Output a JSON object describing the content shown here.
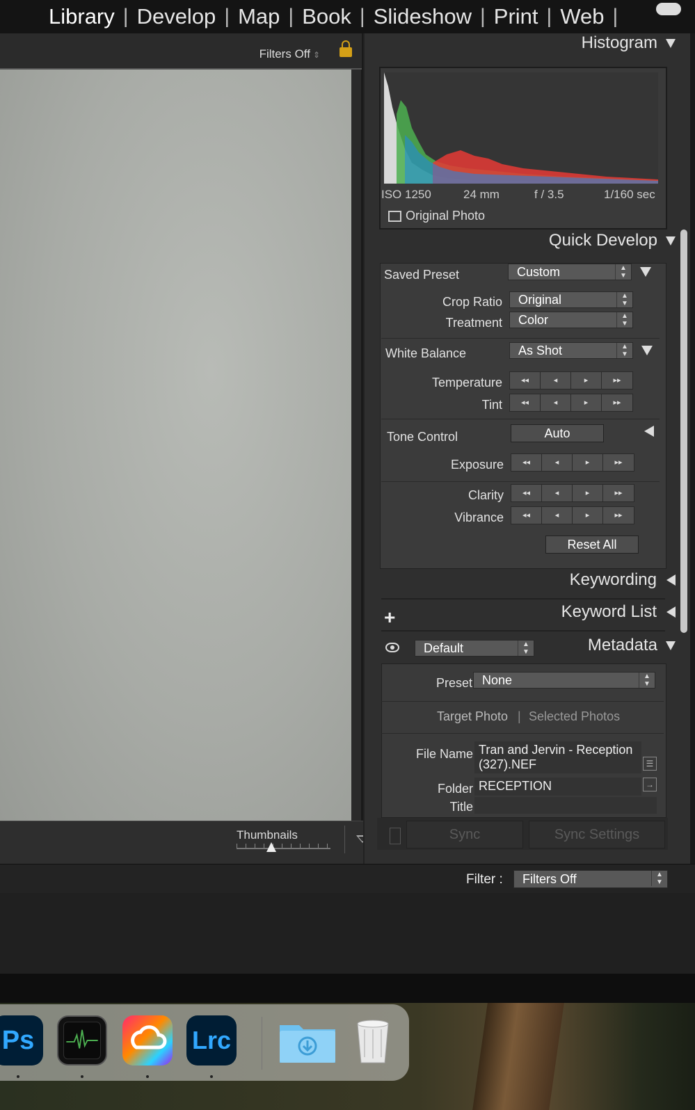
{
  "modules": [
    "Library",
    "Develop",
    "Map",
    "Book",
    "Slideshow",
    "Print",
    "Web"
  ],
  "center": {
    "filter_status": "Filters Off",
    "thumbnails_label": "Thumbnails",
    "thumbnail_size": 0.37
  },
  "histogram": {
    "header": "Histogram",
    "iso": "ISO 1250",
    "focal": "24 mm",
    "aperture": "f / 3.5",
    "shutter": "1/160 sec",
    "original_photo": "Original Photo"
  },
  "quick_develop": {
    "header": "Quick Develop",
    "saved_preset_label": "Saved Preset",
    "saved_preset_value": "Custom",
    "crop_ratio_label": "Crop Ratio",
    "crop_ratio_value": "Original",
    "treatment_label": "Treatment",
    "treatment_value": "Color",
    "white_balance_label": "White Balance",
    "white_balance_value": "As Shot",
    "temperature_label": "Temperature",
    "tint_label": "Tint",
    "tone_control_label": "Tone Control",
    "auto_label": "Auto",
    "exposure_label": "Exposure",
    "clarity_label": "Clarity",
    "vibrance_label": "Vibrance",
    "reset_all_label": "Reset All",
    "stepper_glyphs": [
      "◂◂",
      "◂",
      "▸",
      "▸▸"
    ]
  },
  "keywording": {
    "header": "Keywording"
  },
  "keyword_list": {
    "header": "Keyword List",
    "add": "+"
  },
  "metadata": {
    "header": "Metadata",
    "view_value": "Default",
    "preset_label": "Preset",
    "preset_value": "None",
    "target_photo": "Target Photo",
    "selected_photos": "Selected Photos",
    "file_name_label": "File Name",
    "file_name_line1": "Tran and Jervin - Reception",
    "file_name_line2": "(327).NEF",
    "folder_label": "Folder",
    "folder_value": "RECEPTION",
    "title_label": "Title"
  },
  "sync": {
    "sync_label": "Sync",
    "sync_settings_label": "Sync Settings"
  },
  "filterbar": {
    "label": "Filter :",
    "value": "Filters Off"
  },
  "dock": {
    "ps": "Ps",
    "lrc": "Lrc"
  },
  "colors": {
    "accent_lock": "#d4a017",
    "lrc_blue": "#31a8ff",
    "panel_bg": "#2f2f2f"
  }
}
